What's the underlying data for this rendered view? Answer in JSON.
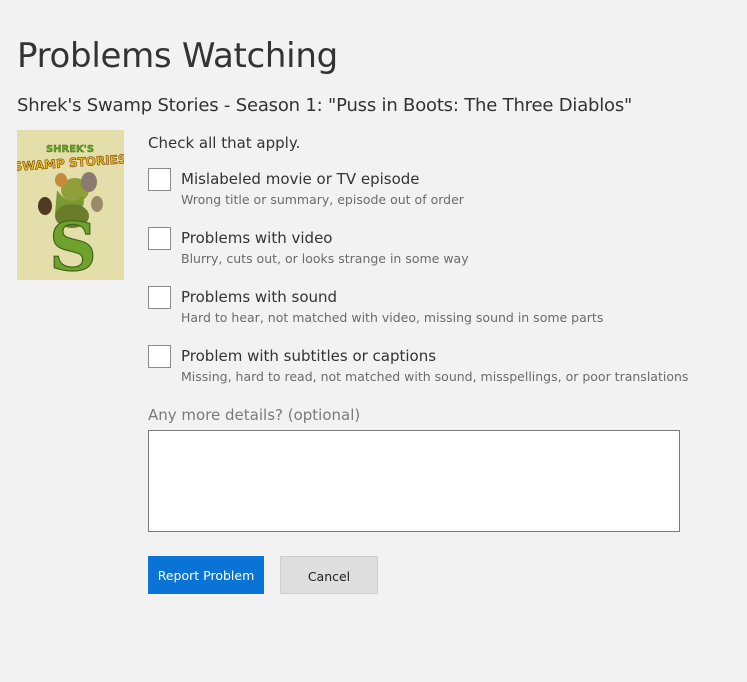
{
  "page": {
    "title": "Problems Watching",
    "subtitle": "Shrek's Swamp Stories - Season 1: \"Puss in Boots: The Three Diablos\""
  },
  "poster": {
    "title_line_1": "SHREK'S",
    "title_line_2": "SWAMP STORIES",
    "letter": "S"
  },
  "form": {
    "instructions": "Check all that apply.",
    "options": [
      {
        "label": "Mislabeled movie or TV episode",
        "description": "Wrong title or summary, episode out of order",
        "checked": false
      },
      {
        "label": "Problems with video",
        "description": "Blurry, cuts out, or looks strange in some way",
        "checked": false
      },
      {
        "label": "Problems with sound",
        "description": "Hard to hear, not matched with video, missing sound in some parts",
        "checked": false
      },
      {
        "label": "Problem with subtitles or captions",
        "description": "Missing, hard to read, not matched with sound, misspellings, or poor translations",
        "checked": false
      }
    ],
    "details_label": "Any more details? (optional)",
    "details_value": ""
  },
  "buttons": {
    "report": "Report Problem",
    "cancel": "Cancel"
  },
  "colors": {
    "background": "#f2f2f2",
    "primary": "#0a74d6",
    "secondary": "#dedede"
  }
}
